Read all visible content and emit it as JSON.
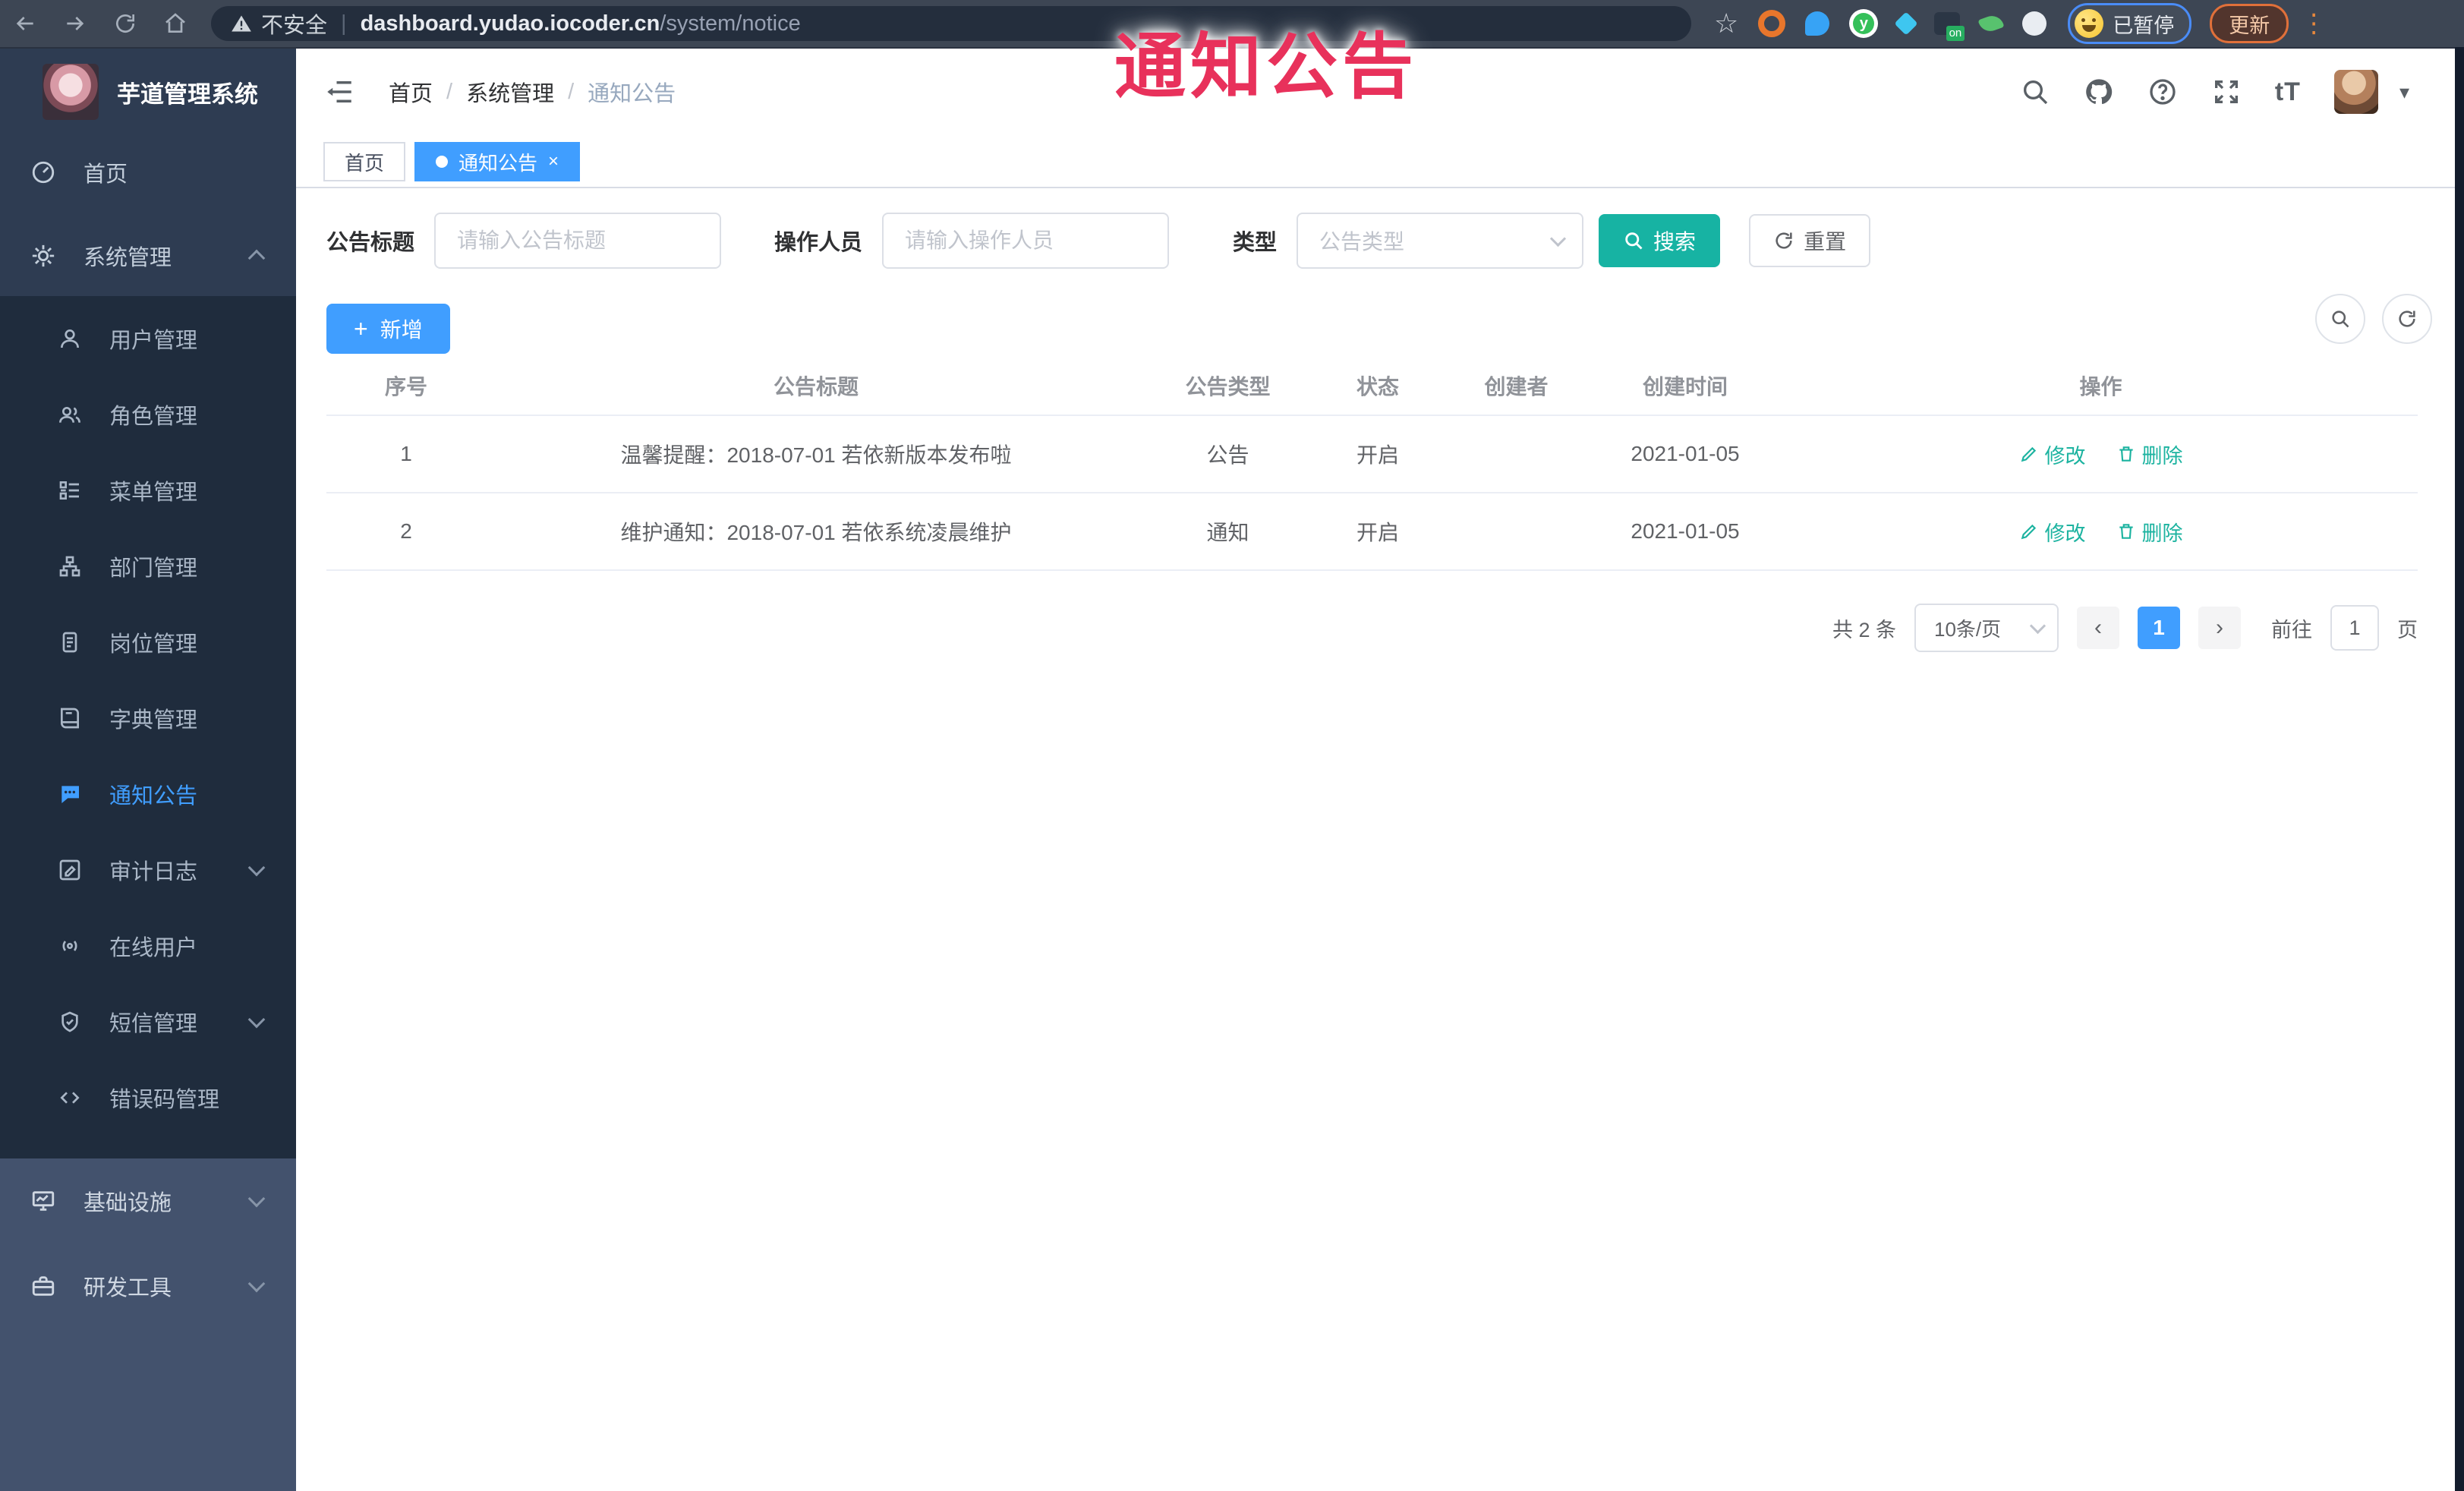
{
  "overlay": {
    "annotation": "通知公告"
  },
  "browser": {
    "security_label": "不安全",
    "url_host": "dashboard.yudao.iocoder.cn",
    "url_path": "/system/notice",
    "profile_chip_label": "已暂停",
    "update_button_label": "更新"
  },
  "glyphs": {
    "star": "☆",
    "pipe": "|",
    "dots": "⋮",
    "slash": "/",
    "caret_down": "▾",
    "plus": "+",
    "close": "×",
    "prev": "‹",
    "next": "›",
    "font_size": "tT",
    "ext_green_letter": "y",
    "ext_on_badge": "on"
  },
  "sidebar": {
    "logo_title": "芋道管理系统",
    "home_label": "首页",
    "system_label": "系统管理",
    "system_children": [
      {
        "label": "用户管理"
      },
      {
        "label": "角色管理"
      },
      {
        "label": "菜单管理"
      },
      {
        "label": "部门管理"
      },
      {
        "label": "岗位管理"
      },
      {
        "label": "字典管理"
      },
      {
        "label": "通知公告"
      },
      {
        "label": "审计日志"
      },
      {
        "label": "在线用户"
      },
      {
        "label": "短信管理"
      },
      {
        "label": "错误码管理"
      }
    ],
    "infra_label": "基础设施",
    "devtools_label": "研发工具"
  },
  "header": {
    "breadcrumb": [
      "首页",
      "系统管理",
      "通知公告"
    ]
  },
  "tabs": [
    {
      "label": "首页"
    },
    {
      "label": "通知公告"
    }
  ],
  "filters": {
    "title_label": "公告标题",
    "title_placeholder": "请输入公告标题",
    "operator_label": "操作人员",
    "operator_placeholder": "请输入操作人员",
    "type_label": "类型",
    "type_placeholder": "公告类型",
    "search_label": "搜索",
    "reset_label": "重置"
  },
  "toolbar": {
    "add_label": "新增"
  },
  "table": {
    "columns": [
      "序号",
      "公告标题",
      "公告类型",
      "状态",
      "创建者",
      "创建时间",
      "操作"
    ],
    "rows": [
      {
        "no": "1",
        "title": "温馨提醒：2018-07-01 若依新版本发布啦",
        "type": "公告",
        "status": "开启",
        "creator": "",
        "created": "2021-01-05"
      },
      {
        "no": "2",
        "title": "维护通知：2018-07-01 若依系统凌晨维护",
        "type": "通知",
        "status": "开启",
        "creator": "",
        "created": "2021-01-05"
      }
    ],
    "action_edit": "修改",
    "action_delete": "删除"
  },
  "pagination": {
    "total": "共 2 条",
    "page_size": "10条/页",
    "current_page": "1",
    "goto_label": "前往",
    "goto_value": "1",
    "goto_unit": "页"
  },
  "icons": {
    "browser": [
      "back-icon",
      "forward-icon",
      "reload-icon",
      "home-icon",
      "warning-icon",
      "bookmark-star-icon",
      "extension-icons",
      "profile-avatar-emoji"
    ],
    "header": [
      "hamburger-icon",
      "search-icon",
      "github-icon",
      "help-icon",
      "fullscreen-icon",
      "font-size-icon",
      "avatar",
      "caret-down-icon"
    ],
    "sidebar": [
      "dashboard-icon",
      "gear-icon",
      "user-icon",
      "users-icon",
      "menu-list-icon",
      "org-tree-icon",
      "post-icon",
      "dict-book-icon",
      "notice-bubble-icon",
      "audit-log-icon",
      "online-user-icon",
      "sms-shield-icon",
      "error-code-icon",
      "infra-monitor-icon",
      "devtools-box-icon"
    ],
    "actions": [
      "plus-icon",
      "search-icon",
      "refresh-icon",
      "edit-pencil-icon",
      "delete-trash-icon"
    ]
  },
  "colors": {
    "accent_blue": "#409EFF",
    "accent_teal": "#17b3a3",
    "annotation_red": "#e8315b",
    "sidebar_top": "#2e3c52",
    "sidebar_submenu": "#1f2c3d",
    "sidebar_bottom": "#43526d",
    "browser_bar": "#3d4654"
  }
}
